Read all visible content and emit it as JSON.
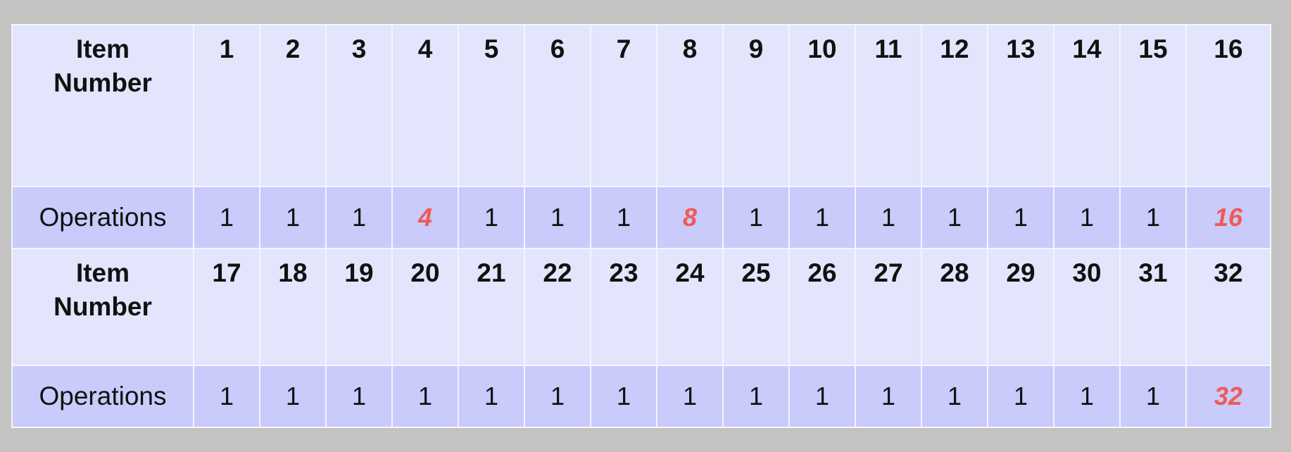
{
  "colors": {
    "background": "#c3c4c1",
    "item_row": "#e3e5fc",
    "operations_row": "#c9cbfb",
    "highlight": "#f05a55"
  },
  "table": {
    "item_label": "Item Number",
    "operations_label": "Operations",
    "blocks": [
      {
        "items": [
          "1",
          "2",
          "3",
          "4",
          "5",
          "6",
          "7",
          "8",
          "9",
          "10",
          "11",
          "12",
          "13",
          "14",
          "15",
          "16"
        ],
        "operations": [
          "1",
          "1",
          "1",
          "4",
          "1",
          "1",
          "1",
          "8",
          "1",
          "1",
          "1",
          "1",
          "1",
          "1",
          "1",
          "16"
        ],
        "highlighted_operations": [
          4,
          8,
          16
        ]
      },
      {
        "items": [
          "17",
          "18",
          "19",
          "20",
          "21",
          "22",
          "23",
          "24",
          "25",
          "26",
          "27",
          "28",
          "29",
          "30",
          "31",
          "32"
        ],
        "operations": [
          "1",
          "1",
          "1",
          "1",
          "1",
          "1",
          "1",
          "1",
          "1",
          "1",
          "1",
          "1",
          "1",
          "1",
          "1",
          "32"
        ],
        "highlighted_operations": [
          32
        ]
      }
    ]
  }
}
